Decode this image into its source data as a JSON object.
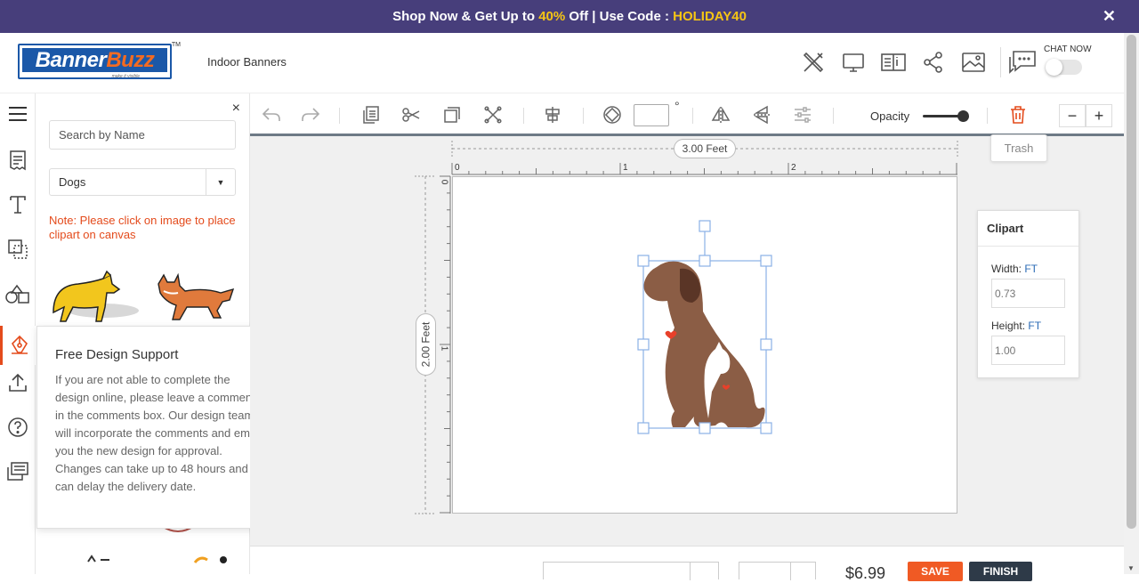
{
  "promo": {
    "part1": "Shop Now & Get Up to ",
    "pct": "40%",
    "part2": " Off | Use Code : ",
    "code": "HOLIDAY40",
    "close": "✕"
  },
  "header": {
    "logo_part1": "Banner",
    "logo_part2": "Buzz",
    "logo_tag": "make it visible",
    "logo_tm": "TM",
    "breadcrumb": "Indoor Banners",
    "chat_label": "CHAT NOW"
  },
  "panel": {
    "close": "×",
    "search_placeholder": "Search by Name",
    "category": "Dogs",
    "note": "Note: Please click on image to place clipart on canvas"
  },
  "popup": {
    "title": "Free Design Support",
    "close": "×",
    "body": "If you are not able to complete the design online, please leave a comments in the comments box. Our design team will incorporate the comments and email you the new design for approval. Changes can take up to 48 hours and can delay the delivery date."
  },
  "toolbar": {
    "angle_value": "",
    "degree": "°",
    "opacity_label": "Opacity",
    "opacity_value": 1.0,
    "trash_tooltip": "Trash",
    "zoom_out": "−",
    "zoom_in": "+"
  },
  "canvas": {
    "width_label": "3.00 Feet",
    "height_label": "2.00 Feet",
    "ruler_x": [
      "0",
      "1",
      "2"
    ],
    "ruler_y": [
      "0",
      "1"
    ]
  },
  "clipart_props": {
    "title": "Clipart",
    "width_label": "Width: ",
    "height_label": "Height: ",
    "unit": "FT",
    "width_value": "0.73",
    "height_value": "1.00"
  },
  "bottom": {
    "price": "$6.99",
    "save": "SAVE",
    "finish": "FINISH"
  },
  "colors": {
    "promo_bg": "#473e7b",
    "promo_highlight": "#f6c514",
    "brand_blue": "#1b58a8",
    "brand_orange": "#f36b21",
    "note_red": "#e44b1c",
    "save_btn": "#f05a24",
    "finish_btn": "#2e3a48",
    "dog_brown": "#8b5d45"
  }
}
